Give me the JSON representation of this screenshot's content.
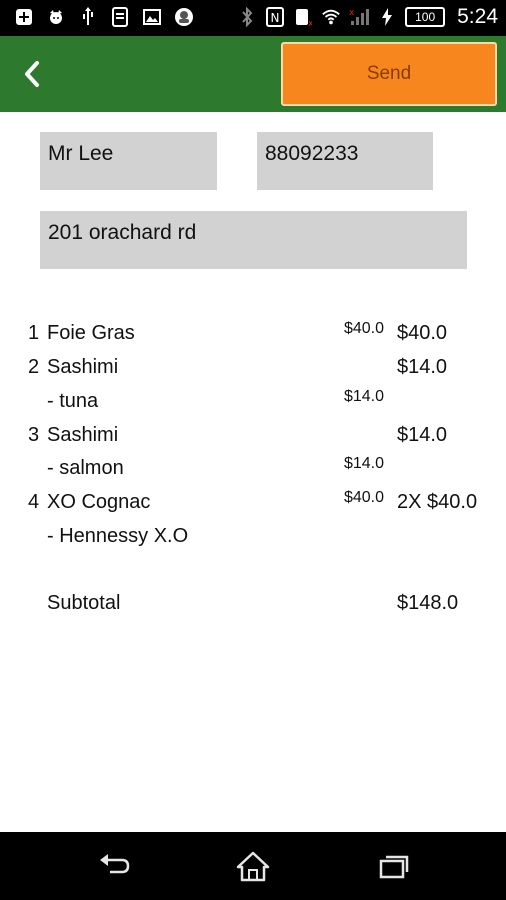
{
  "status_bar": {
    "time": "5:24",
    "battery": "100",
    "icons": [
      "add-icon",
      "cat-icon",
      "usb-icon",
      "sim-icon",
      "image-icon",
      "avatar-icon",
      "bluetooth-icon",
      "nfc-icon",
      "no-sim-icon",
      "wifi-icon",
      "signal-icon",
      "charging-icon",
      "battery-icon"
    ]
  },
  "toolbar": {
    "back_icon": "chevron-left-icon",
    "send_label": "Send",
    "colors": {
      "bar": "#2d7a2e",
      "send_button": "#f7861f"
    }
  },
  "form": {
    "name": "Mr Lee",
    "phone": "88092233",
    "address": "201 orachard rd"
  },
  "order": {
    "rows": [
      {
        "num": "1",
        "name": "Foie Gras",
        "unit_price": "$40.0",
        "total": "$40.0"
      },
      {
        "num": "2",
        "name": "Sashimi",
        "unit_price": "",
        "total": "$14.0"
      },
      {
        "num": "",
        "name": "- tuna",
        "unit_price": "$14.0",
        "total": ""
      },
      {
        "num": "3",
        "name": "Sashimi",
        "unit_price": "",
        "total": "$14.0"
      },
      {
        "num": "",
        "name": "- salmon",
        "unit_price": "$14.0",
        "total": ""
      },
      {
        "num": "4",
        "name": "XO Cognac",
        "unit_price": "$40.0",
        "total": "2X $40.0"
      },
      {
        "num": "",
        "name": "- Hennessy X.O",
        "unit_price": "",
        "total": ""
      }
    ],
    "subtotal_label": "Subtotal",
    "subtotal_value": "$148.0"
  },
  "nav_bar": {
    "icons": [
      "back-icon",
      "home-icon",
      "recents-icon"
    ]
  }
}
